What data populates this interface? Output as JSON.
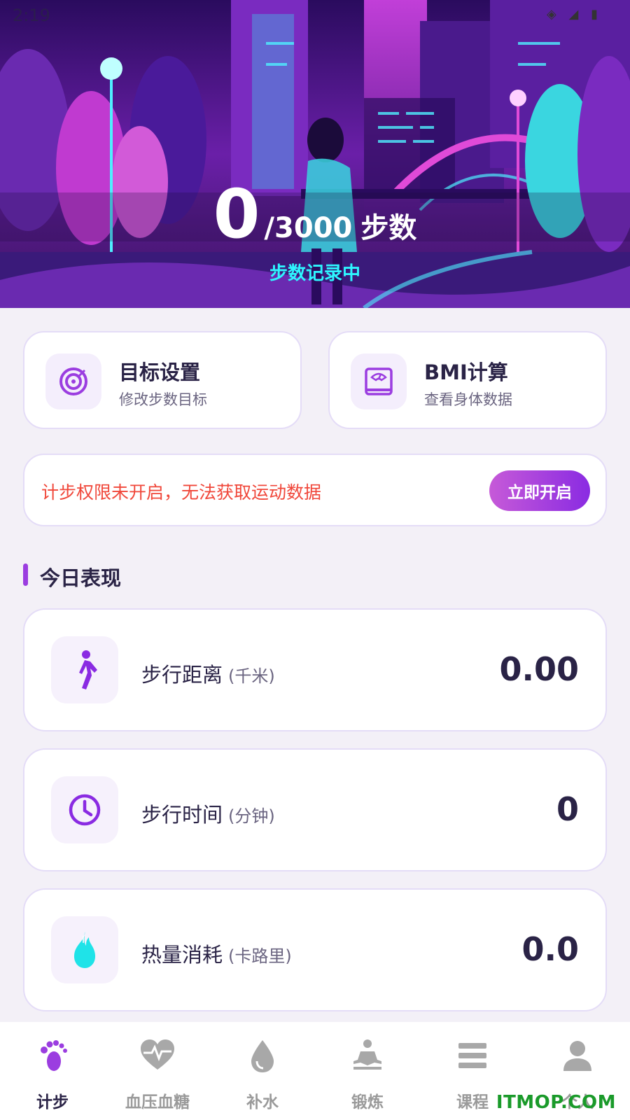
{
  "status_bar": {
    "time": "2:19",
    "icons": "◈ ◢ ▮"
  },
  "hero": {
    "current_steps": "0",
    "goal": "/3000",
    "unit": "步数",
    "status": "步数记录中"
  },
  "quick_actions": [
    {
      "title": "目标设置",
      "subtitle": "修改步数目标",
      "icon": "target-icon"
    },
    {
      "title": "BMI计算",
      "subtitle": "查看身体数据",
      "icon": "scale-icon"
    }
  ],
  "permission": {
    "message": "计步权限未开启，无法获取运动数据",
    "button": "立即开启"
  },
  "section": {
    "title": "今日表现"
  },
  "metrics": [
    {
      "label": "步行距离",
      "unit": "(千米)",
      "value": "0.00",
      "icon": "walking-icon"
    },
    {
      "label": "步行时间",
      "unit": "(分钟)",
      "value": "0",
      "icon": "clock-icon"
    },
    {
      "label": "热量消耗",
      "unit": "(卡路里)",
      "value": "0.0",
      "icon": "flame-icon"
    }
  ],
  "nav": [
    {
      "label": "计步",
      "icon": "footprint-icon",
      "active": true
    },
    {
      "label": "血压血糖",
      "icon": "heart-pulse-icon",
      "active": false
    },
    {
      "label": "补水",
      "icon": "water-drop-icon",
      "active": false
    },
    {
      "label": "锻炼",
      "icon": "meditation-icon",
      "active": false
    },
    {
      "label": "课程",
      "icon": "list-icon",
      "active": false
    },
    {
      "label": "个人",
      "icon": "user-icon",
      "active": false
    }
  ],
  "watermark": "ITMOP.COM",
  "colors": {
    "accent": "#9b3de0",
    "warning": "#f0473a",
    "status_cyan": "#2ef6ff",
    "text_dark": "#2a2346"
  }
}
